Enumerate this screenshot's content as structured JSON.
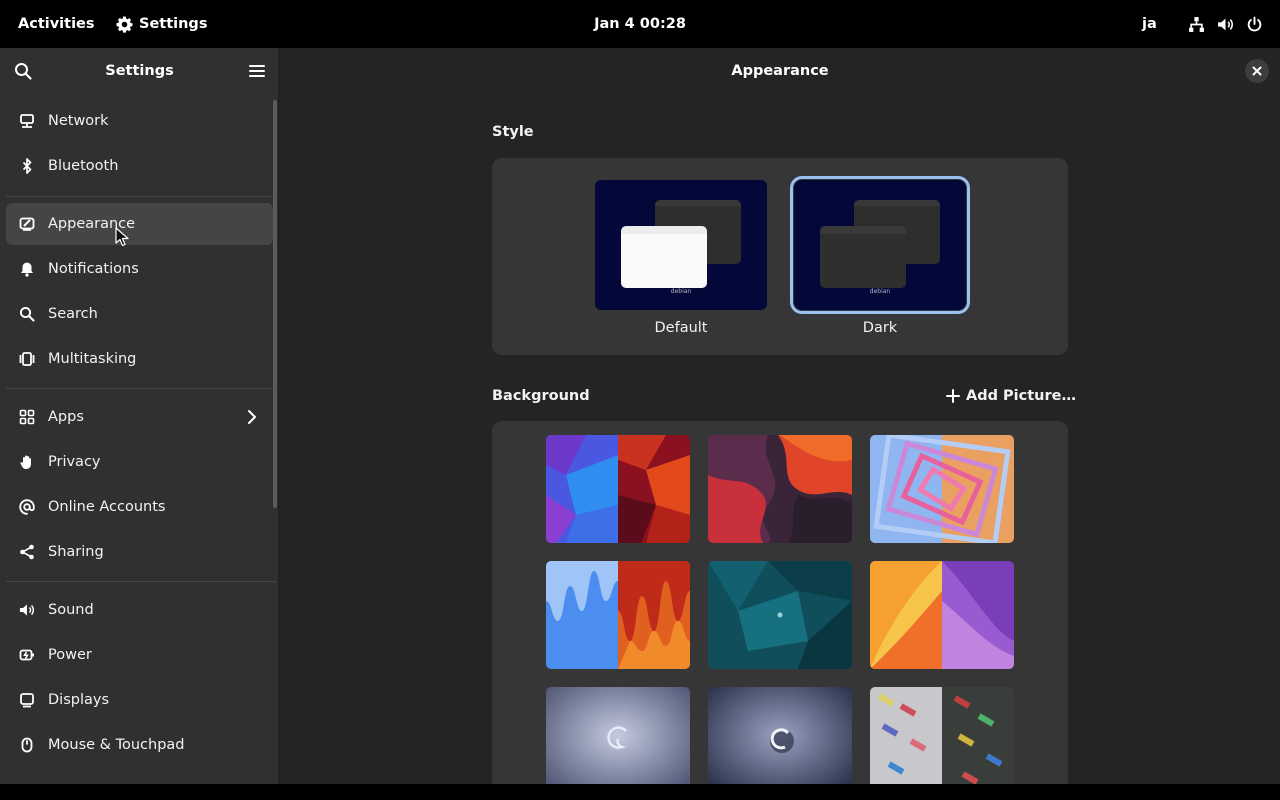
{
  "topbar": {
    "activities": "Activities",
    "app_name": "Settings",
    "clock": "Jan 4  00:28",
    "language": "ja"
  },
  "sidebar": {
    "title": "Settings",
    "items": [
      {
        "label": "Network",
        "icon": "network-icon"
      },
      {
        "label": "Bluetooth",
        "icon": "bluetooth-icon"
      },
      {
        "label": "Appearance",
        "icon": "appearance-icon",
        "selected": true
      },
      {
        "label": "Notifications",
        "icon": "bell-icon"
      },
      {
        "label": "Search",
        "icon": "search-icon"
      },
      {
        "label": "Multitasking",
        "icon": "multitasking-icon"
      },
      {
        "label": "Apps",
        "icon": "apps-grid-icon",
        "has_submenu": true
      },
      {
        "label": "Privacy",
        "icon": "hand-icon"
      },
      {
        "label": "Online Accounts",
        "icon": "at-sign-icon"
      },
      {
        "label": "Sharing",
        "icon": "share-icon"
      },
      {
        "label": "Sound",
        "icon": "speaker-icon"
      },
      {
        "label": "Power",
        "icon": "power-plug-icon"
      },
      {
        "label": "Displays",
        "icon": "display-icon"
      },
      {
        "label": "Mouse & Touchpad",
        "icon": "mouse-icon"
      }
    ]
  },
  "content": {
    "title": "Appearance",
    "style": {
      "label": "Style",
      "options": [
        {
          "label": "Default",
          "selected": false
        },
        {
          "label": "Dark",
          "selected": true
        }
      ],
      "thumb_brand": "debian"
    },
    "background": {
      "label": "Background",
      "add_picture": "Add Picture…"
    }
  },
  "colors": {
    "accent": "#99c1f1",
    "window_bg": "#242424",
    "sidebar_bg": "#303030",
    "card_bg": "#363636"
  }
}
